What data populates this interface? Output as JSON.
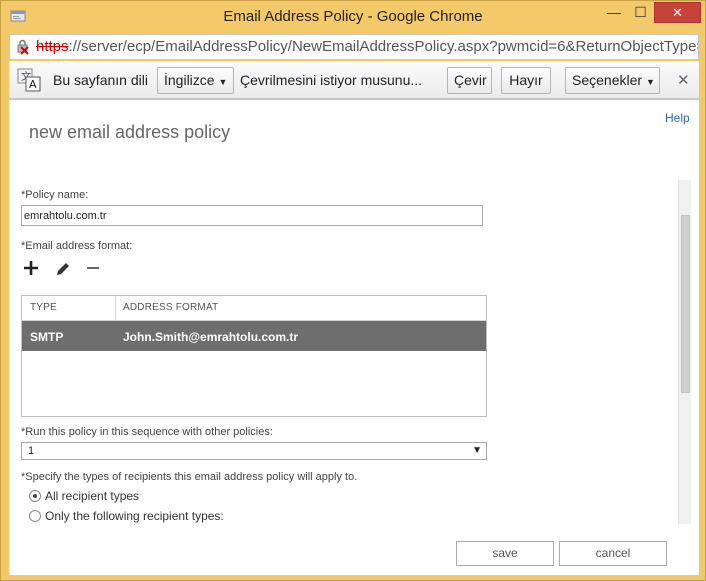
{
  "window": {
    "title": "Email Address Policy - Google Chrome",
    "minimize_glyph": "—",
    "maximize_glyph": "☐",
    "close_glyph": "✕"
  },
  "address": {
    "scheme": "https",
    "rest": "://server/ecp/EmailAddressPolicy/NewEmailAddressPolicy.aspx?pwmcid=6&ReturnObjectType="
  },
  "translate": {
    "prompt": "Bu sayfanın dili",
    "language": "İngilizce",
    "question": "Çevrilmesini istiyor musunu...",
    "translate_button": "Çevir",
    "no_button": "Hayır",
    "options_button": "Seçenekler",
    "close_glyph": "✕"
  },
  "page": {
    "help": "Help",
    "title": "new email address policy",
    "policy_name_label": "*Policy name:",
    "policy_name_value": "emrahtolu.com.tr",
    "address_format_label": "*Email address format:",
    "grid": {
      "columns": [
        "TYPE",
        "ADDRESS FORMAT"
      ],
      "rows": [
        {
          "type": "SMTP",
          "format": "John.Smith@emrahtolu.com.tr"
        }
      ]
    },
    "sequence_label": "*Run this policy in this sequence with other policies:",
    "sequence_value": "1",
    "recipients_label": "*Specify the types of recipients this email address policy will apply to.",
    "radio_all": "All recipient types",
    "radio_following": "Only the following recipient types:",
    "save": "save",
    "cancel": "cancel"
  },
  "colors": {
    "title_bar": "#f4c96a",
    "close_button": "#c7433a",
    "selected_row": "#6e6e6e",
    "help_link": "#2a67b0"
  }
}
